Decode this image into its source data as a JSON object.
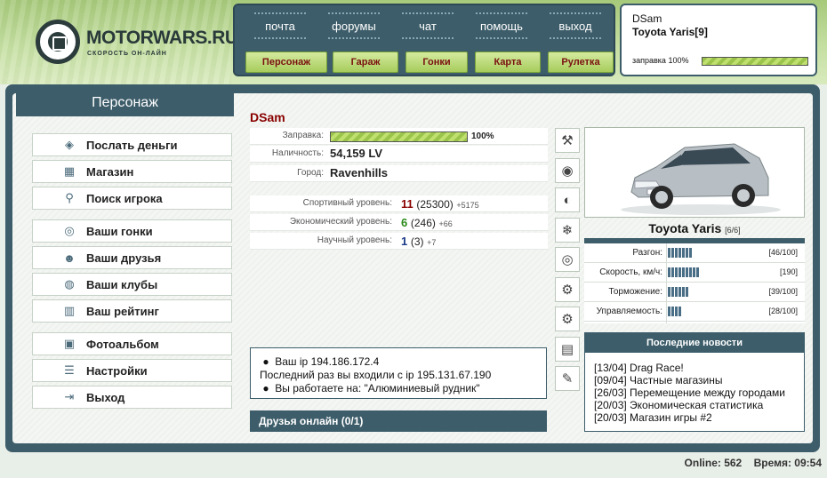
{
  "logo": {
    "title": "MOTORWARS.RU",
    "subtitle": "СКОРОСТЬ ОН-ЛАЙН"
  },
  "topnav": {
    "links": [
      "почта",
      "форумы",
      "чат",
      "помощь",
      "выход"
    ],
    "buttons": [
      "Персонаж",
      "Гараж",
      "Гонки",
      "Карта",
      "Рулетка"
    ]
  },
  "userbox": {
    "name": "DSam",
    "car": "Toyota Yaris[9]",
    "fuel_label": "заправка 100%",
    "fuel_fraction": 1.0
  },
  "sidebar": {
    "title": "Персонаж",
    "items": [
      {
        "label": "Послать деньги",
        "icon": "money-icon"
      },
      {
        "label": "Магазин",
        "icon": "shop-icon"
      },
      {
        "label": "Поиск игрока",
        "icon": "magnifier-icon"
      },
      {
        "label": "Ваши гонки",
        "icon": "steering-wheel-icon"
      },
      {
        "label": "Ваши друзья",
        "icon": "friends-icon"
      },
      {
        "label": "Ваши клубы",
        "icon": "globe-icon"
      },
      {
        "label": "Ваш рейтинг",
        "icon": "rating-chart-icon"
      },
      {
        "label": "Фотоальбом",
        "icon": "camera-icon"
      },
      {
        "label": "Настройки",
        "icon": "sliders-icon"
      },
      {
        "label": "Выход",
        "icon": "exit-icon"
      }
    ]
  },
  "character": {
    "name": "DSam",
    "fuel_label": "Заправка:",
    "fuel_fraction": 1.0,
    "fuel_pct": "100%",
    "cash_label": "Наличность:",
    "cash": "54,159 LV",
    "city_label": "Город:",
    "city": "Ravenhills",
    "levels": [
      {
        "label": "Спортивный уровень:",
        "level": "11",
        "points": "(25300)",
        "delta": "+5175",
        "color": "#8a0000"
      },
      {
        "label": "Экономический уровень:",
        "level": "6",
        "points": "(246)",
        "delta": "+66",
        "color": "#2a8a1a"
      },
      {
        "label": "Научный уровень:",
        "level": "1",
        "points": "(3)",
        "delta": "+7",
        "color": "#1a3a8a"
      }
    ]
  },
  "info": {
    "ip": "Ваш ip 194.186.172.4",
    "last": "Последний раз вы входили с ip 195.131.67.190",
    "work": "Вы работаете на: \"Алюминиевый рудник\""
  },
  "friends": {
    "label": "Друзья онлайн (0/1)"
  },
  "parts": [
    "suspension-icon",
    "tire-icon",
    "exhaust-icon",
    "turbo-icon",
    "brake-disc-icon",
    "gears-icon",
    "transmission-icon",
    "engine-block-icon",
    "wrench-parts-icon"
  ],
  "car": {
    "name": "Toyota Yaris",
    "slots": "[6/6]",
    "stats": [
      {
        "label": "Разгон:",
        "value": "[46/100]",
        "fraction": 0.46
      },
      {
        "label": "Скорость, км/ч:",
        "value": "[190]",
        "fraction": 0.55
      },
      {
        "label": "Торможение:",
        "value": "[39/100]",
        "fraction": 0.39
      },
      {
        "label": "Управляемость:",
        "value": "[28/100]",
        "fraction": 0.28
      }
    ]
  },
  "news": {
    "title": "Последние новости",
    "items": [
      "[13/04] Drag Race!",
      "[09/04] Частные магазины",
      "[26/03] Перемещение между городами",
      "[20/03] Экономическая статистика",
      "[20/03] Магазин игры #2"
    ]
  },
  "footer": {
    "online": "Online: 562",
    "time": "Время: 09:54"
  },
  "colors": {
    "accent": "#3d5d6a",
    "button_green": "#a7cc5c",
    "name_red": "#8a0000"
  }
}
